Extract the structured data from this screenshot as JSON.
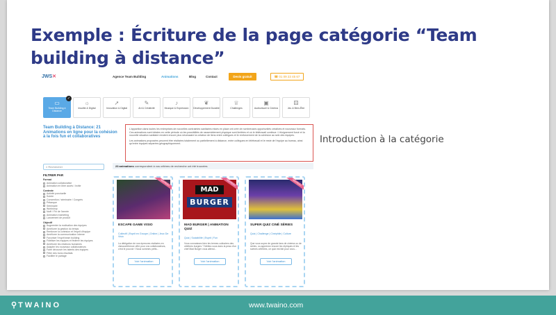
{
  "slide": {
    "title": "Exemple : Écriture de la page catégorie “Team building à distance”",
    "annotation": "Introduction à la catégorie"
  },
  "site": {
    "logo_text": "",
    "nav": [
      "Agence Team Building",
      "Animations",
      "Blog",
      "Contact"
    ],
    "quote_button": "Devis gratuit",
    "phone_button": "01 09 23 45 67",
    "categories": [
      {
        "label": "Team Building à Distance",
        "icon": "laptop-icon",
        "selected": true
      },
      {
        "label": "Insolite & Digital",
        "icon": "bulb-icon",
        "selected": false
      },
      {
        "label": "Innovation & Digital",
        "icon": "rocket-icon",
        "selected": false
      },
      {
        "label": "Art & Créativité",
        "icon": "palette-icon",
        "selected": false
      },
      {
        "label": "Musique & Expression",
        "icon": "music-icon",
        "selected": false
      },
      {
        "label": "Développement Durable",
        "icon": "leaf-icon",
        "selected": false
      },
      {
        "label": "Challenges",
        "icon": "trophy-icon",
        "selected": false
      },
      {
        "label": "Audiovisuel & Cinéma",
        "icon": "film-icon",
        "selected": false
      },
      {
        "label": "Jeu & Bien-Être",
        "icon": "dice-icon",
        "selected": false
      }
    ],
    "page_heading": "Team Building à Distance: 21 Animations en ligne pour la cohésion à la fois fun et collaboratives",
    "intro_paragraphs": [
      "L'apparition dans toutes les entreprises de nouvelles contraintes sanitaires mises en place ont créé de nombreuses opportunités créatives et nouveaux formats. Ces animations sont idéales en cette période où les possibilités de rassemblement physique sont limitées et où le télétravail continue. L'éloignement forcé et la nouvelle situation sanitaire rendent encore plus nécessaire la création de liens entre collègues et le renforcement de la cohésion au sein des équipes.",
      "Les animations proposées peuvent être réalisées totalement ou partiellement à distance, entre collègues en télétravail et le reste de l'équipe au bureau, ainsi qu'entre équipes séparées géographiquement."
    ],
    "search_placeholder": "Rechercher",
    "filters": {
      "title": "FILTRER PAR",
      "groups": [
        {
          "name": "Format",
          "options": [
            "Animation collaborative",
            "Animation en libre accès / Invite"
          ]
        },
        {
          "name": "Contexte",
          "options": [
            "Activité ponctuelle",
            "Soirée",
            "Convention / séminaire / Congrès",
            "Pétanque",
            "Séminaire",
            "Workshop",
            "Noël / Fin de l'année",
            "Animation marketing",
            "Lancement de produit"
          ]
        },
        {
          "name": "Objectif",
          "options": [
            "Augmenter la motivation des équipes",
            "Améliorer la gestion du temps",
            "Renforcer la cohésion et l'esprit d'équipe",
            "Améliorer la communication interne",
            "Favoriser l'esprit team building",
            "Fidéliser les équipes et fédérer les équipes",
            "Améliorer les relations humaines",
            "Adapter les nouveaux collaborateurs",
            "Faire découvrir les talents des équipes",
            "Fêter des bons résultats",
            "Faciliter le partage"
          ]
        }
      ]
    },
    "results": {
      "count": "23 animations",
      "text": "correspondent à vos critères de recherche ont été trouvées"
    },
    "cards": [
      {
        "title": "ESCAPE GAME VISIO",
        "tags": "Collectif | Esprit en Groupe | Online | Jeux De Visio",
        "desc": "La délégation de nos épreuves réalisées en visioconférence offre pour vos collaborateurs, c'est le pouvoir ! Nous sommes prêts...",
        "button": "Voir l'animation",
        "ribbon": "NOUVEAU"
      },
      {
        "title": "MAD BURGER | ANIMATION QUIZ",
        "tags": "Quiz | Sociabilité | Esprit | Fun",
        "desc": "Vous connaissez bien les termes culinaires des célèbres burgers ? Mettez-vous dans la peau d'un chef Mad Burger vous attend...",
        "button": "Voir l'animation",
        "ribbon": "NOUVEAU",
        "image_text_top": "MAD",
        "image_text_bottom": "BURGER"
      },
      {
        "title": "SUPER QUIZ CINÉ SÉRIES",
        "tags": "Quiz | Challenge | Cinéphile | Culture",
        "desc": "Que vous soyez de grands fans de cinéma ou de séries, ou apprenez encore les répliques et les scènes célèbres, ce quiz est fait pour vous...",
        "button": "Voir l'animation",
        "ribbon": "NOUVEAU"
      }
    ]
  },
  "footer": {
    "logo": "TWAINO",
    "url": "www.twaino.com"
  }
}
